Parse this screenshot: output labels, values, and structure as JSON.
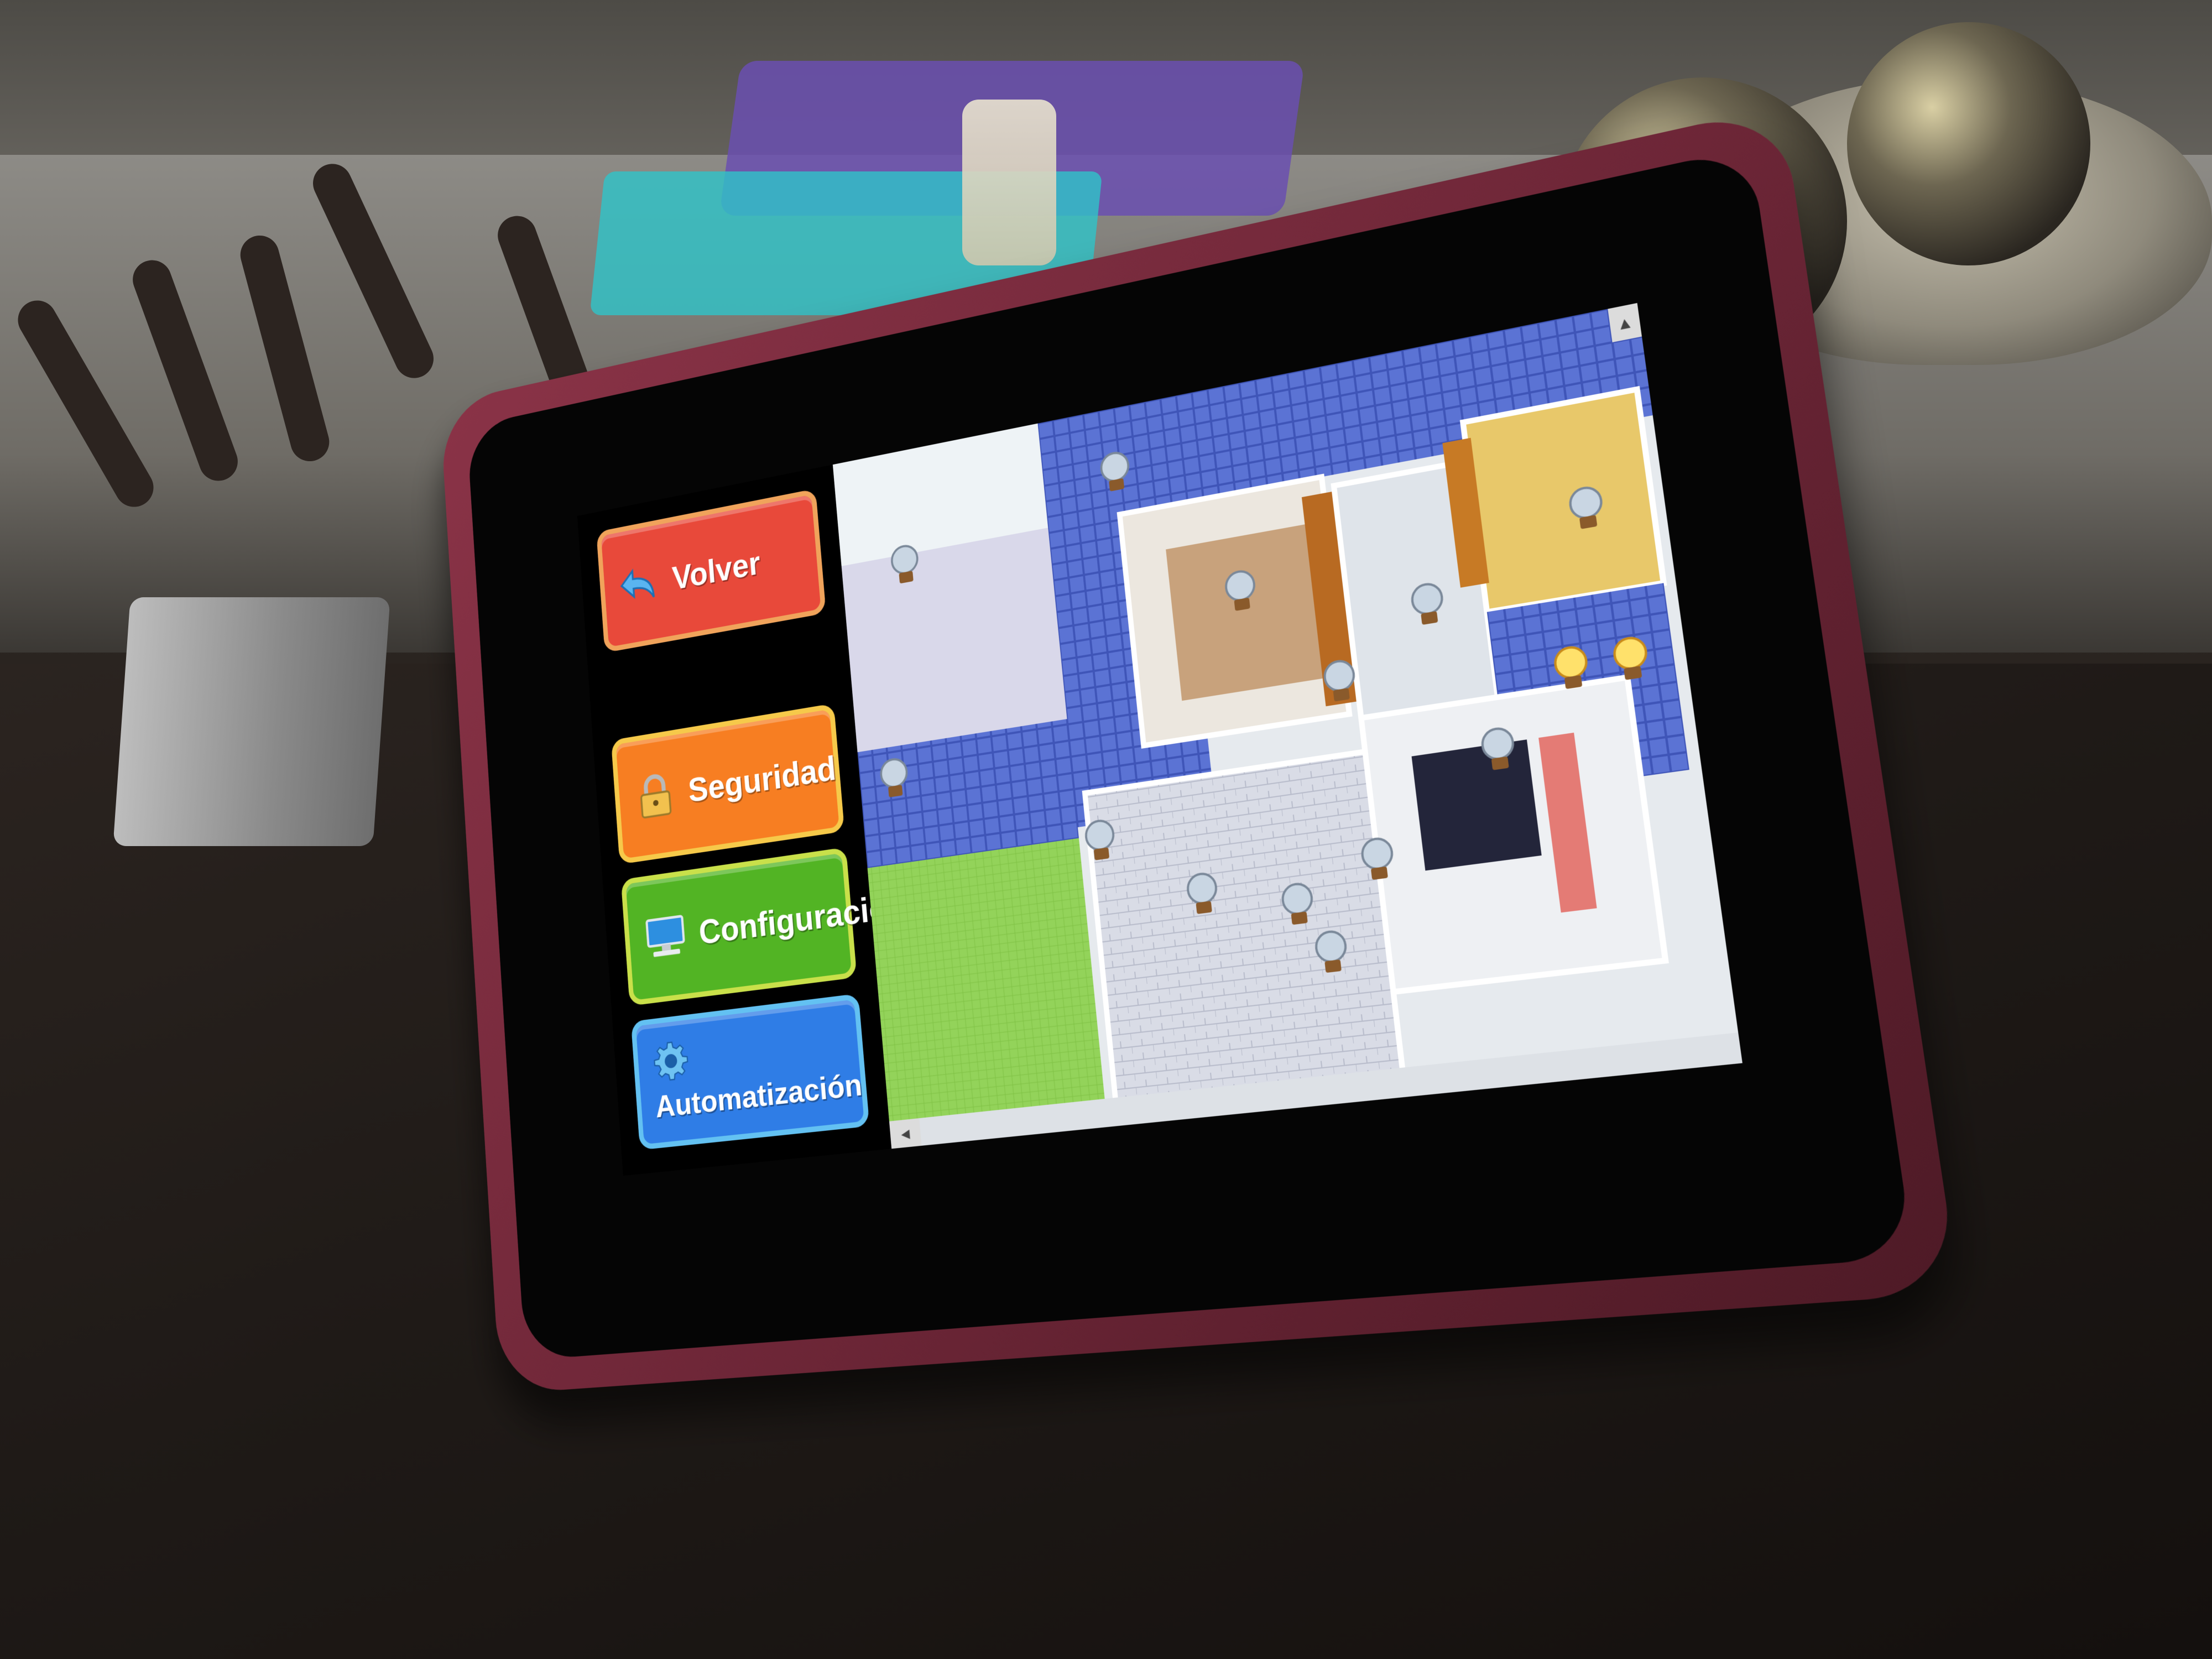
{
  "menu": {
    "back_label": "Volver",
    "security_label": "Seguridad",
    "settings_label": "Configuración",
    "automation_label": "Automatización"
  },
  "icons": {
    "back": "back-arrow-icon",
    "security": "padlock-icon",
    "settings": "computer-icon",
    "automation": "gear-icon",
    "light": "light-bulb-icon"
  },
  "colors": {
    "back": "#e8493a",
    "security": "#f77e22",
    "settings": "#52b424",
    "automation": "#2f7de6",
    "case": "#7a2c3e"
  },
  "floorplan": {
    "lights": [
      {
        "room": "top-left-patio",
        "state": "off"
      },
      {
        "room": "bathroom-pool",
        "state": "off"
      },
      {
        "room": "living-room",
        "state": "off"
      },
      {
        "room": "hall-1",
        "state": "off"
      },
      {
        "room": "bedroom-1",
        "state": "off"
      },
      {
        "room": "hall-2",
        "state": "off"
      },
      {
        "room": "corridor",
        "state": "on"
      },
      {
        "room": "left-patio",
        "state": "off"
      },
      {
        "room": "garden",
        "state": "off"
      },
      {
        "room": "kitchen",
        "state": "off"
      },
      {
        "room": "lounge",
        "state": "off"
      },
      {
        "room": "bedroom-2",
        "state": "off"
      },
      {
        "room": "bedroom-3",
        "state": "off"
      },
      {
        "room": "laundry",
        "state": "on"
      },
      {
        "room": "terrace",
        "state": "off"
      }
    ]
  }
}
